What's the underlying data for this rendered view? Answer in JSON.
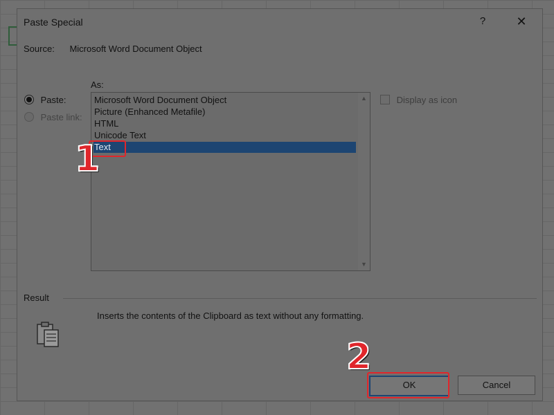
{
  "dialog": {
    "title": "Paste Special",
    "help_label": "?",
    "close_label": "✕"
  },
  "source": {
    "label": "Source:",
    "value": "Microsoft Word Document Object"
  },
  "options": {
    "paste_label": "Paste:",
    "paste_link_label": "Paste link:",
    "selected": "paste"
  },
  "as_list": {
    "label": "As:",
    "items": [
      "Microsoft Word Document Object",
      "Picture (Enhanced Metafile)",
      "HTML",
      "Unicode Text",
      "Text"
    ],
    "selected_index": 4
  },
  "display_as_icon": {
    "label": "Display as icon",
    "checked": false
  },
  "result": {
    "label": "Result",
    "text": "Inserts the contents of the Clipboard as text without any formatting."
  },
  "buttons": {
    "ok": "OK",
    "cancel": "Cancel"
  },
  "annotations": {
    "step1": "1",
    "step2": "2"
  },
  "colors": {
    "highlight": "#e0262b",
    "selection": "#1d4572"
  }
}
